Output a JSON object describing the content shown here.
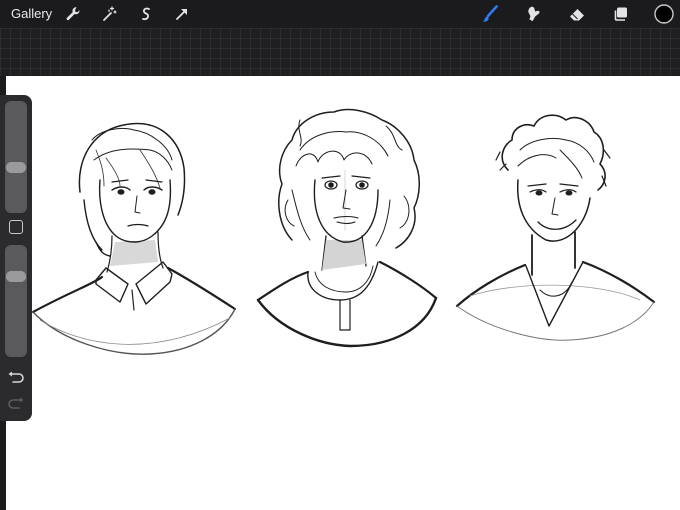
{
  "toolbar": {
    "gallery_label": "Gallery",
    "left_tools": [
      "wrench-icon",
      "magic-wand-icon",
      "selection-icon",
      "transform-arrow-icon"
    ],
    "right_tools": [
      "brush-icon",
      "smudge-icon",
      "eraser-icon",
      "layers-icon",
      "color-swatch"
    ],
    "active_tool": "brush",
    "accent_color": "#2f7bf6",
    "current_color": "#000000"
  },
  "sidebar": {
    "brush_size_level": 0.38,
    "opacity_level": 0.74,
    "controls": [
      "brush-size-slider",
      "modify-button",
      "opacity-slider",
      "undo-icon",
      "redo-icon"
    ],
    "redo_enabled": false
  }
}
